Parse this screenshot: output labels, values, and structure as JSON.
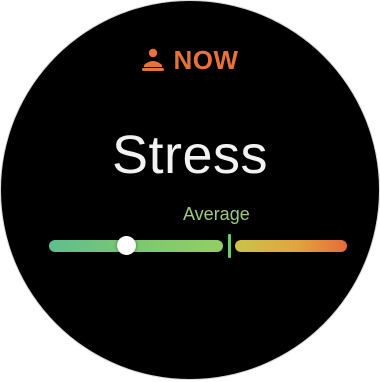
{
  "header": {
    "icon": "meditation-person-icon",
    "label": "NOW"
  },
  "title": "Stress",
  "status": {
    "level_text": "Average",
    "stress_position_fraction": 0.26
  },
  "colors": {
    "accent": "#e5733a",
    "title_text": "#f2f2f2",
    "level_text": "#9cc97e"
  }
}
